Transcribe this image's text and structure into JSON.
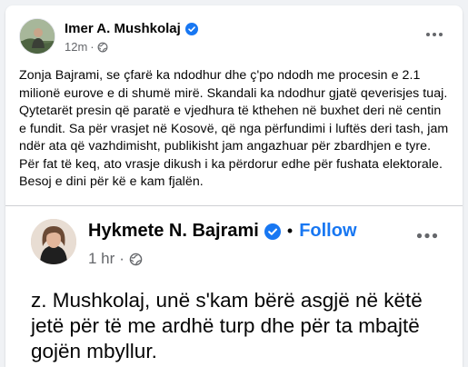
{
  "post": {
    "author": "Imer A. Mushkolaj",
    "time": "12m",
    "separator": "·",
    "text": "Zonja Bajrami, se çfarë ka ndodhur dhe ç'po ndodh me procesin e 2.1 milionë eurove e di shumë mirë. Skandali ka ndodhur gjatë qeverisjes tuaj. Qytetarët presin që paratë e vjedhura të kthehen në buxhet deri në centin e fundit. Sa për vrasjet në Kosovë, që nga përfundimi i luftës deri tash, jam ndër ata që vazhdimisht, publikisht jam angazhuar për zbardhjen e tyre. Për fat të keq, ato vrasje dikush i ka përdorur edhe për fushata elektorale. Besoj e dini për kë e kam fjalën."
  },
  "embedded_post": {
    "author": "Hykmete N. Bajrami",
    "separator": "•",
    "follow_label": "Follow",
    "time": "1 hr",
    "meta_separator": "·",
    "text": "z. Mushkolaj, unë s'kam bërë asgjë në këtë jetë për të me ardhë turp dhe për ta mbajtë gojën mbyllur."
  },
  "colors": {
    "accent": "#1877f2",
    "secondary_text": "#65676b",
    "background": "#f0f2f5"
  },
  "icons": [
    "verified-badge-icon",
    "globe-icon",
    "more-options-icon"
  ]
}
